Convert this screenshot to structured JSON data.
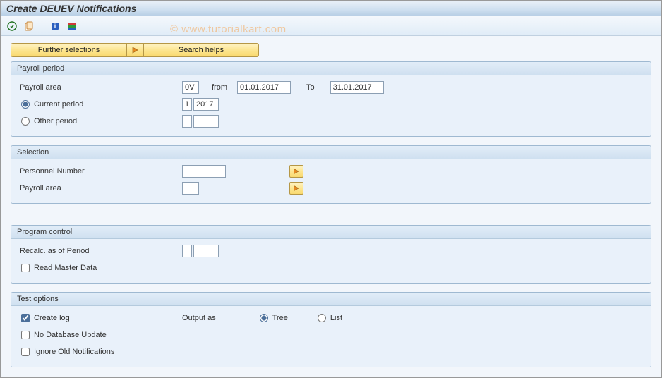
{
  "title": "Create DEUEV Notifications",
  "watermark": "© www.tutorialkart.com",
  "toolbar": {
    "icons": [
      "execute-icon",
      "get-variant-icon",
      "info-icon",
      "variants-icon"
    ]
  },
  "top_buttons": {
    "further_selections": "Further selections",
    "search_helps": "Search helps"
  },
  "groups": {
    "payroll_period": {
      "title": "Payroll period",
      "payroll_area_label": "Payroll area",
      "payroll_area_value": "0V",
      "from_label": "from",
      "from_value": "01.01.2017",
      "to_label": "To",
      "to_value": "31.01.2017",
      "current_period_label": "Current period",
      "current_period_selected": true,
      "current_period_num": "1",
      "current_period_year": "2017",
      "other_period_label": "Other period",
      "other_period_num": "",
      "other_period_year": ""
    },
    "selection": {
      "title": "Selection",
      "personnel_number_label": "Personnel Number",
      "personnel_number_value": "",
      "payroll_area_label": "Payroll area",
      "payroll_area_value": ""
    },
    "program_control": {
      "title": "Program control",
      "recalc_label": "Recalc. as of Period",
      "recalc_num": "",
      "recalc_year": "",
      "read_master_data_label": "Read Master Data",
      "read_master_data_checked": false
    },
    "test_options": {
      "title": "Test options",
      "create_log_label": "Create log",
      "create_log_checked": true,
      "output_as_label": "Output as",
      "tree_label": "Tree",
      "list_label": "List",
      "output_as_value": "tree",
      "no_db_update_label": "No Database Update",
      "no_db_update_checked": false,
      "ignore_old_label": "Ignore Old Notifications",
      "ignore_old_checked": false
    }
  }
}
